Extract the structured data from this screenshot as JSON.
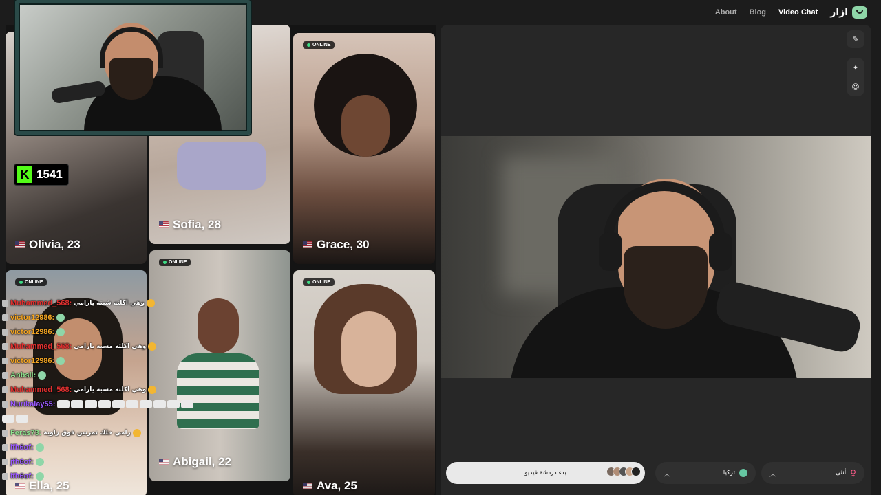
{
  "nav": {
    "about": "About",
    "blog": "Blog",
    "video_chat": "Video Chat",
    "brand": "ازار"
  },
  "grid": {
    "cards": [
      {
        "name": "Olivia, 23",
        "online": ""
      },
      {
        "name": "Sofia, 28",
        "online": ""
      },
      {
        "name": "Grace, 30",
        "online": "ONLINE"
      },
      {
        "name": "Ella, 25",
        "online": "ONLINE"
      },
      {
        "name": "Abigail, 22",
        "online": "ONLINE"
      },
      {
        "name": "Ava, 25",
        "online": "ONLINE"
      }
    ]
  },
  "stream": {
    "viewer_count": "1541",
    "platform_logo": "K"
  },
  "chat": {
    "messages": [
      {
        "user": "Muhammed_568:",
        "text": "وهي اكلته شبته يارامي",
        "color": "#e0302f"
      },
      {
        "user": "victor12986:",
        "text": "",
        "color": "#f5a623"
      },
      {
        "user": "victor12986:",
        "text": "",
        "color": "#f5a623"
      },
      {
        "user": "Muhammed_568:",
        "text": "وهي اكلته مسبه يارامي",
        "color": "#e0302f"
      },
      {
        "user": "victor12986:",
        "text": "",
        "color": "#f5a623"
      },
      {
        "user": "Anbsii:",
        "text": "",
        "color": "#8fe38f"
      },
      {
        "user": "Muhammed_568:",
        "text": "وهي اكلته مسبه يارامي",
        "color": "#e0302f"
      },
      {
        "user": "Nurikalay55:",
        "text": "",
        "color": "#9b59ff"
      },
      {
        "user": "",
        "text": "",
        "color": "#ffffff"
      },
      {
        "user": "Feras73:",
        "text": "رامي خلك تمرنين فوق زاوية",
        "color": "#8fe38f"
      },
      {
        "user": "lfh6of:",
        "text": "",
        "color": "#9b59ff"
      },
      {
        "user": "jfh6of:",
        "text": "",
        "color": "#9b59ff"
      },
      {
        "user": "lfh6of:",
        "text": "",
        "color": "#9b59ff"
      }
    ]
  },
  "controls": {
    "start_label": "بدء دردشة فيديو",
    "country_label": "تركيا",
    "gender_label": "أنثى"
  },
  "icons": {
    "edit": "edit-icon",
    "effects": "sparkle-icon",
    "sticker": "sticker-icon",
    "chevron": "chevron-up-icon",
    "gender": "female-icon"
  },
  "colors": {
    "accent_green": "#8fd6a8",
    "kick_green": "#53fc18",
    "online_dot": "#3ddc84"
  }
}
